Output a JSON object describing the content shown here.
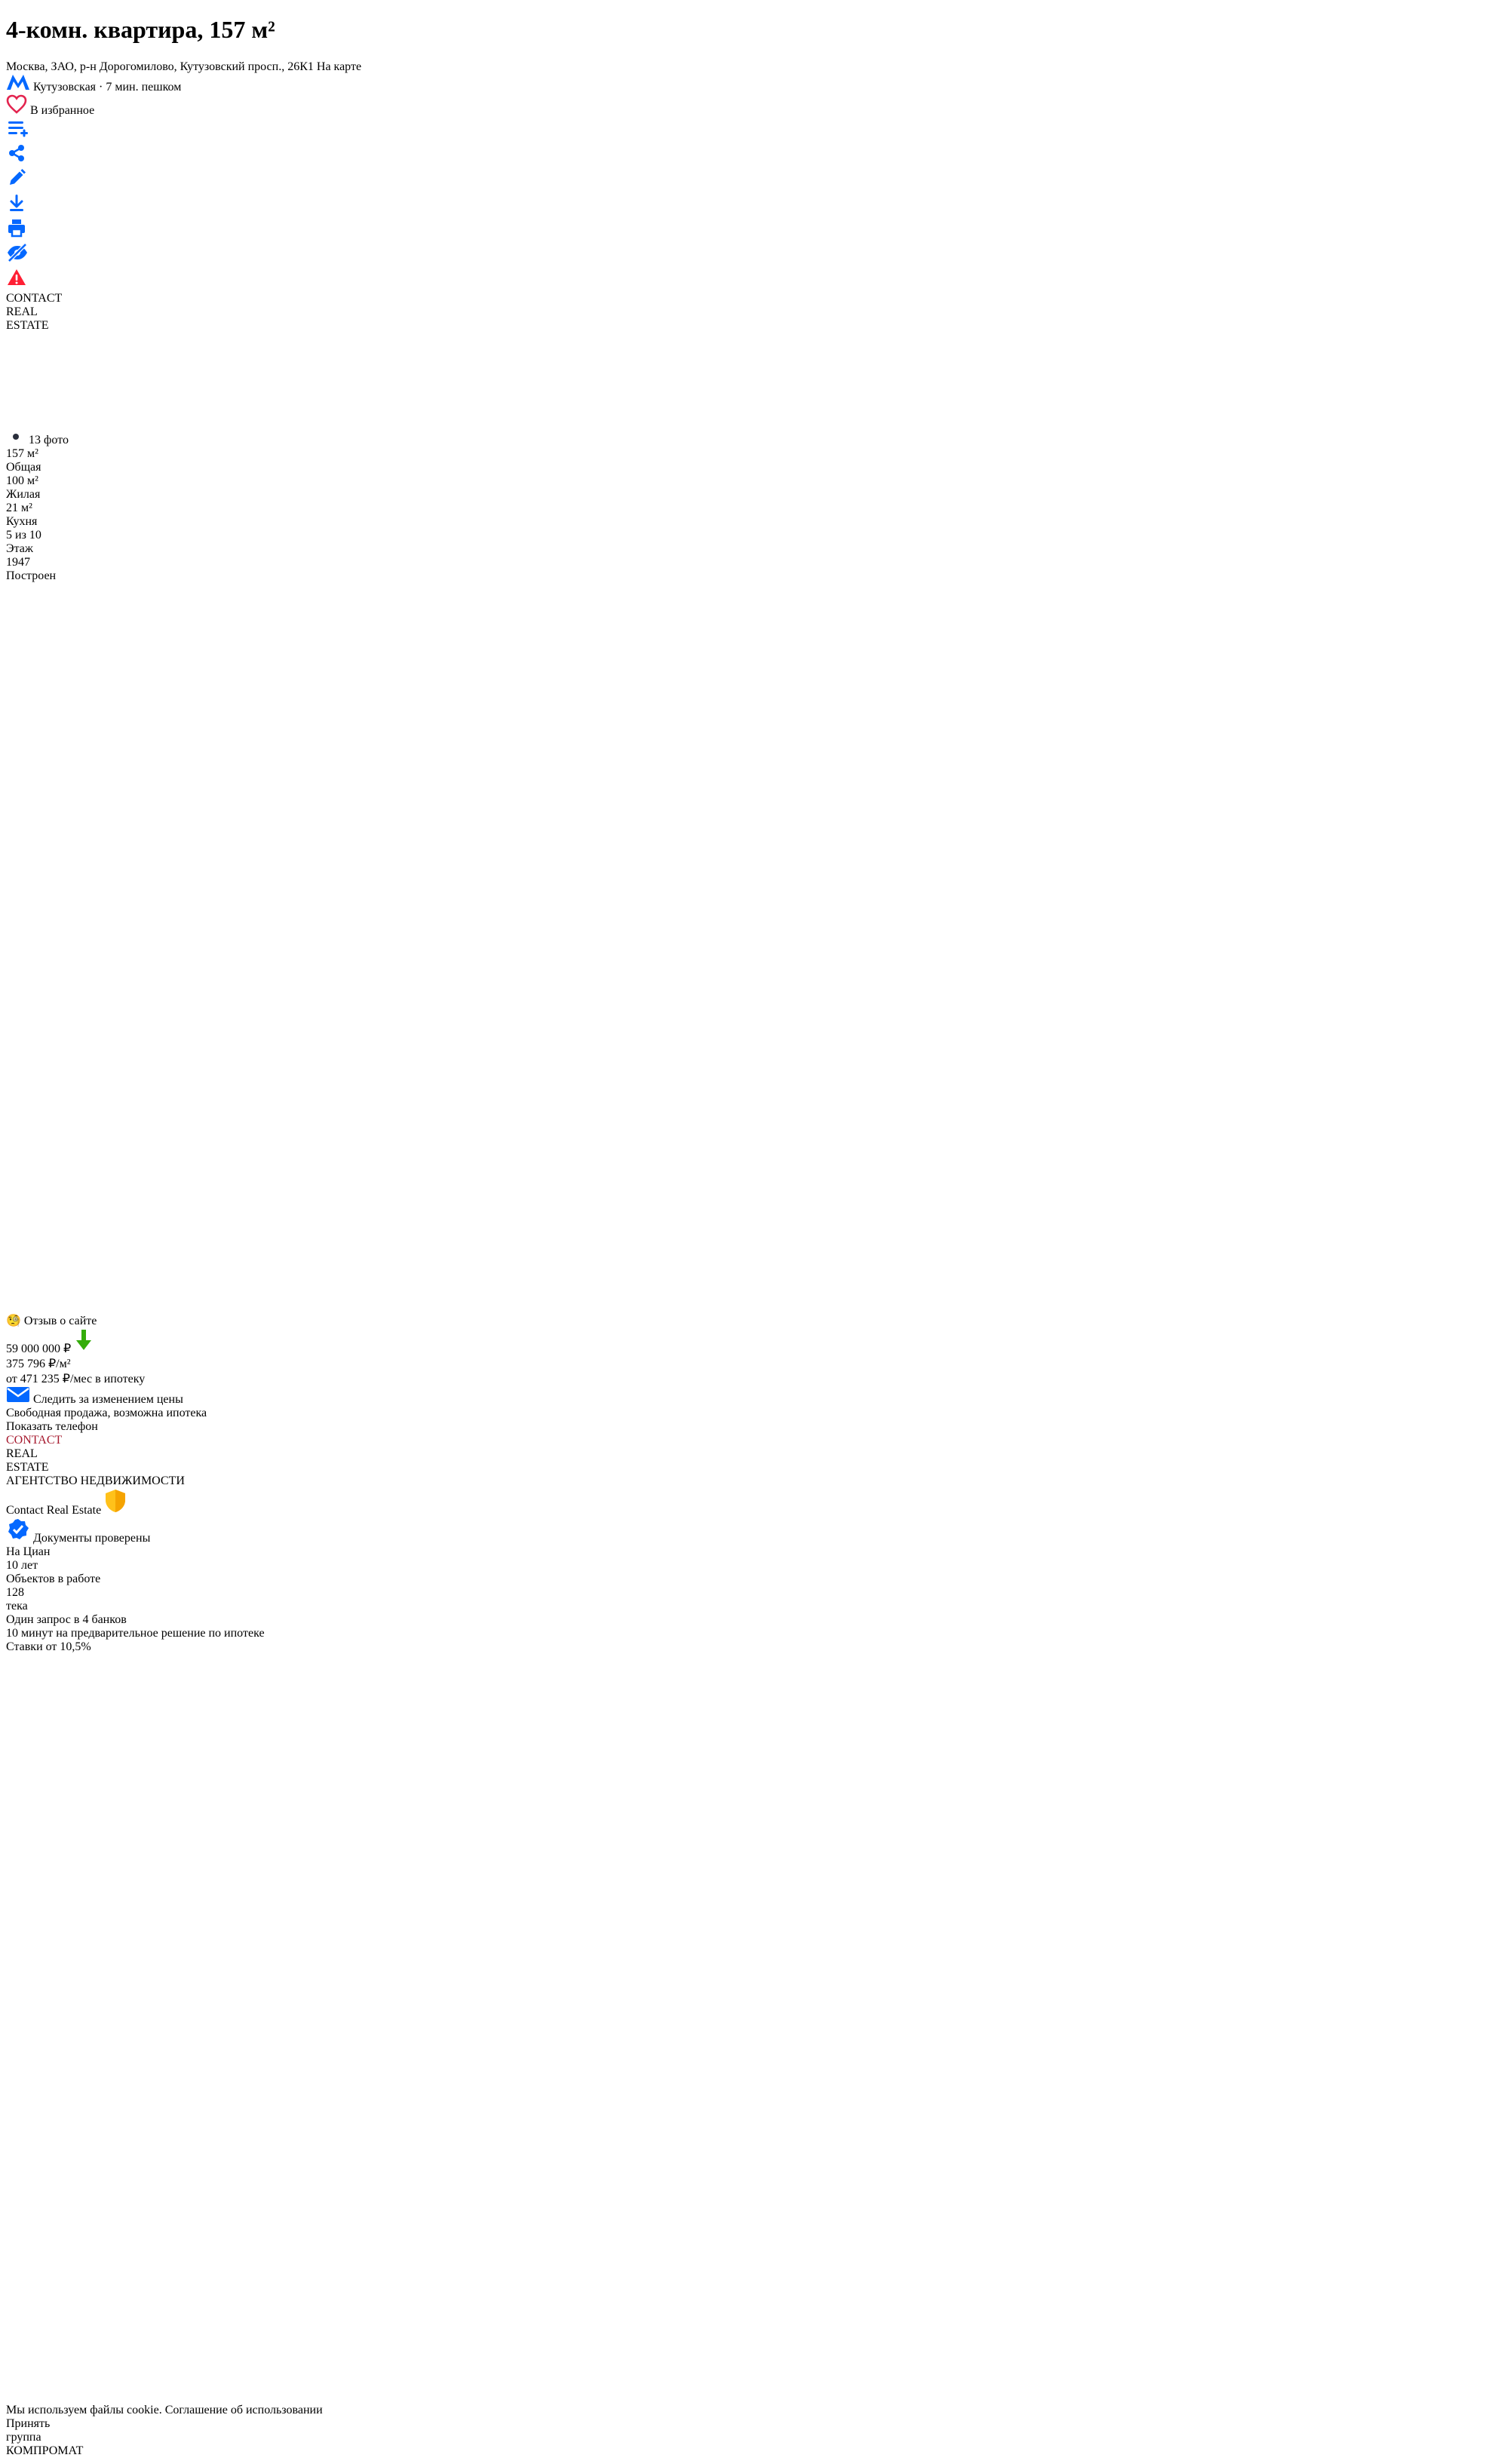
{
  "listing": {
    "title": "4-комн. квартира, 157 м²",
    "address": "Москва, ЗАО, р-н Дорогомилово, Кутузовский просп., 26К1",
    "map_link": "На карте",
    "metro_name": "Кутузовская",
    "metro_sep": "·",
    "metro_time": "7 мин. пешком",
    "metro_logo": "М"
  },
  "actions": {
    "favorite_label": "В избранное",
    "icons": [
      "compare-icon",
      "share-icon",
      "edit-icon",
      "download-icon",
      "print-icon",
      "hide-icon",
      "report-icon"
    ]
  },
  "gallery": {
    "watermark": [
      "CONTACT",
      "REAL",
      "ESTATE"
    ],
    "photo_count": "13 фото",
    "thumb_count": 9,
    "selected_index": 0
  },
  "feedback": {
    "label": "Отзыв о сайте",
    "emoji": "🧐"
  },
  "stats": [
    {
      "value": "157 м²",
      "label": "Общая"
    },
    {
      "value": "100 м²",
      "label": "Жилая"
    },
    {
      "value": "21 м²",
      "label": "Кухня"
    },
    {
      "value": "5 из 10",
      "label": "Этаж"
    }
  ],
  "built": {
    "value": "1947",
    "label": "Построен"
  },
  "price": {
    "amount": "59 000 000 ₽",
    "per_meter": "375 796 ₽/м²",
    "mortgage_link": "от 471 235 ₽/мес в ипотеку",
    "follow_label": "Следить за изменением цены",
    "sale_type": "Свободная продажа, возможна ипотека",
    "phone_button": "Показать телефон",
    "trend": "down"
  },
  "agency": {
    "logo_text": [
      "CONTACT",
      "REAL",
      "ESTATE"
    ],
    "kind": "АГЕНТСТВО НЕДВИЖИМОСТИ",
    "name": "Contact Real Estate",
    "verified": "Документы проверены",
    "stats": [
      {
        "label": "На Циан",
        "value": "10 лет"
      },
      {
        "label": "Объектов в работе",
        "value": "128"
      }
    ]
  },
  "mortgage_card": {
    "title": "тека",
    "line1": "Один запрос в 4 банков",
    "line2": "10 минут на предварительное решение по ипотеке",
    "rates_link": "Ставки от 10,5%"
  },
  "cookie": {
    "text": "Мы используем файлы cookie.",
    "link": "Соглашение об использовании",
    "accept": "Принять"
  },
  "watermark": {
    "small": "группа",
    "main": "КОМПРОМАТ"
  },
  "colors": {
    "accent": "#0468FF",
    "text": "#152242",
    "muted": "#737A8E",
    "price_down": "#34AC0A",
    "cookie_bg": "#152242",
    "agency_brand": "#A6192E"
  }
}
